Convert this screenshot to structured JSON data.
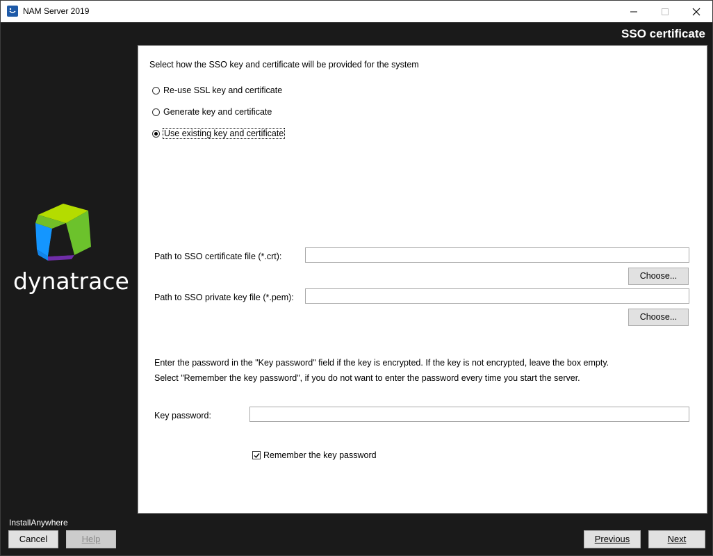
{
  "window": {
    "title": "NAM Server 2019"
  },
  "header": {
    "title": "SSO certificate"
  },
  "sidebar": {
    "logo_text": "dynatrace",
    "installer_label": "InstallAnywhere"
  },
  "main": {
    "intro": "Select how the SSO key and certificate will be provided for the system",
    "options": [
      {
        "label": "Re-use SSL key and certificate",
        "selected": false
      },
      {
        "label": "Generate key and certificate",
        "selected": false
      },
      {
        "label": "Use existing key and certificate",
        "selected": true
      }
    ],
    "cert_path_label": "Path to SSO certificate file (*.crt):",
    "cert_path_value": "",
    "key_path_label": "Path to SSO private key file (*.pem):",
    "key_path_value": "",
    "choose_label": "Choose...",
    "info_line1": "Enter the password in the \"Key password\" field if the key is encrypted. If the key is not encrypted, leave the box empty.",
    "info_line2": "Select \"Remember the key password\", if you do not want to enter the password every time you start the server.",
    "key_password_label": "Key password:",
    "key_password_value": "",
    "remember_label": "Remember the key password",
    "remember_checked": true
  },
  "footer": {
    "cancel": "Cancel",
    "help": "Help",
    "previous": "Previous",
    "next": "Next"
  },
  "colors": {
    "background": "#1a1a1a",
    "logo_green": "#6cc22c",
    "logo_blue": "#1496ff",
    "logo_purple": "#6f2da8"
  }
}
